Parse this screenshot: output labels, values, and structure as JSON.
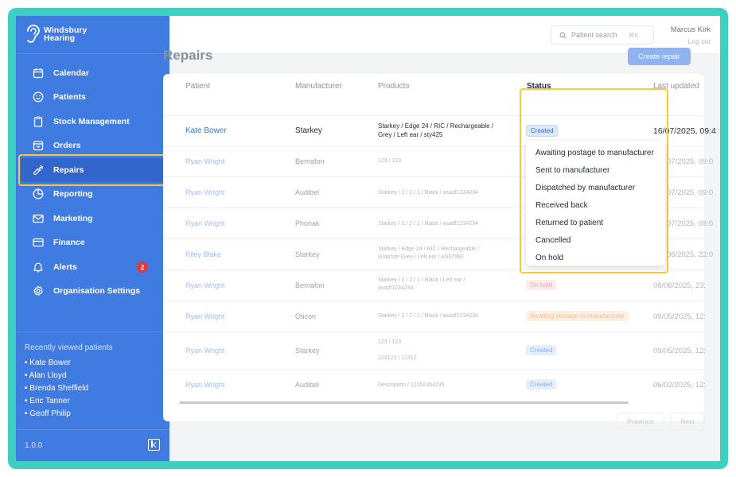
{
  "brand": {
    "line1": "Windsbury",
    "line2": "Hearing"
  },
  "nav": [
    {
      "label": "Calendar",
      "icon": "calendar-icon"
    },
    {
      "label": "Patients",
      "icon": "smile-icon"
    },
    {
      "label": "Stock Management",
      "icon": "clipboard-icon"
    },
    {
      "label": "Orders",
      "icon": "box-icon"
    },
    {
      "label": "Repairs",
      "icon": "wrench-icon",
      "active": true
    },
    {
      "label": "Reporting",
      "icon": "pie-chart-icon"
    },
    {
      "label": "Marketing",
      "icon": "mail-icon"
    },
    {
      "label": "Finance",
      "icon": "credit-card-icon"
    },
    {
      "label": "Alerts",
      "icon": "bell-icon",
      "badge": "2"
    },
    {
      "label": "Organisation Settings",
      "icon": "gear-icon"
    }
  ],
  "recent": {
    "title": "Recently viewed patients",
    "items": [
      "• Kate Bower",
      "• Alan Lloyd",
      "• Brenda Sheffield",
      "• Eric Tanner",
      "• Geoff Philip"
    ]
  },
  "version": "1.0.0",
  "topbar": {
    "search_placeholder": "Patient search",
    "search_shortcut": "⌘K",
    "user_name": "Marcus Kirk",
    "logout": "Log out"
  },
  "page": {
    "title": "Repairs",
    "create_button": "Create repair"
  },
  "table": {
    "headers": [
      "Patient",
      "Manufacturer",
      "Products",
      "Status",
      "Last updated"
    ],
    "rows": [
      {
        "patient": "Kate Bower",
        "manufacturer": "Starkey",
        "products": [
          "Starkey / Edge 24 / RIC / Rechargeable /",
          "Grey / Left ear / sty425"
        ],
        "status": "Created",
        "status_kind": "created",
        "updated": "16/07/2025, 09:4"
      },
      {
        "patient": "Ryan Wright",
        "manufacturer": "Bernafon",
        "products": [
          "123 / 123"
        ],
        "status": "",
        "status_kind": "",
        "updated": "07/2025, 09:0"
      },
      {
        "patient": "Ryan Wright",
        "manufacturer": "Audibel",
        "products": [
          "Starkey / 2 / 2 / 1 / Black / asadf1234234"
        ],
        "status": "",
        "status_kind": "",
        "updated": "07/2025, 09:0"
      },
      {
        "patient": "Ryan Wright",
        "manufacturer": "Phonak",
        "products": [
          "Starkey / 2 / 2 / 1 / Black / asadf1234234"
        ],
        "status": "",
        "status_kind": "",
        "updated": "07/2025, 09:0"
      },
      {
        "patient": "Riley Blake",
        "manufacturer": "Starkey",
        "products": [
          "Starkey / Edge 24 / RIC / Rechargeable /",
          "Graphite Grey / Left ear / AS67992"
        ],
        "status": "",
        "status_kind": "",
        "updated": "06/2025, 22:0"
      },
      {
        "patient": "Ryan Wright",
        "manufacturer": "Bernafon",
        "products": [
          "Starkey / 2 / 2 / 1 / Black / Left ear /",
          "asadf1234234"
        ],
        "status": "On hold",
        "status_kind": "onhold",
        "updated": "08/06/2025, 23:"
      },
      {
        "patient": "Ryan Wright",
        "manufacturer": "Oticon",
        "products": [
          "Starkey / 2 / 2 / 1 / Black / asadf1234234"
        ],
        "status": "Awaiting postage to manufacturer",
        "status_kind": "await",
        "updated": "09/05/2025, 12:"
      },
      {
        "patient": "Ryan Wright",
        "manufacturer": "Starkey",
        "products": [
          "123 / 123",
          "",
          "123123 / 12312"
        ],
        "status": "Created",
        "status_kind": "created",
        "updated": "09/05/2025, 12:"
      },
      {
        "patient": "Ryan Wright",
        "manufacturer": "Audibel",
        "products": [
          "Description / 12352354235"
        ],
        "status": "Created",
        "status_kind": "created",
        "updated": "06/02/2025, 12:"
      }
    ]
  },
  "status_dropdown": {
    "options": [
      "Awaiting postage to manufacturer",
      "Sent to manufacturer",
      "Dispatched by manufacturer",
      "Received back",
      "Returned to patient",
      "Cancelled",
      "On hold"
    ]
  },
  "pagination": {
    "previous": "Previous",
    "next": "Next"
  }
}
